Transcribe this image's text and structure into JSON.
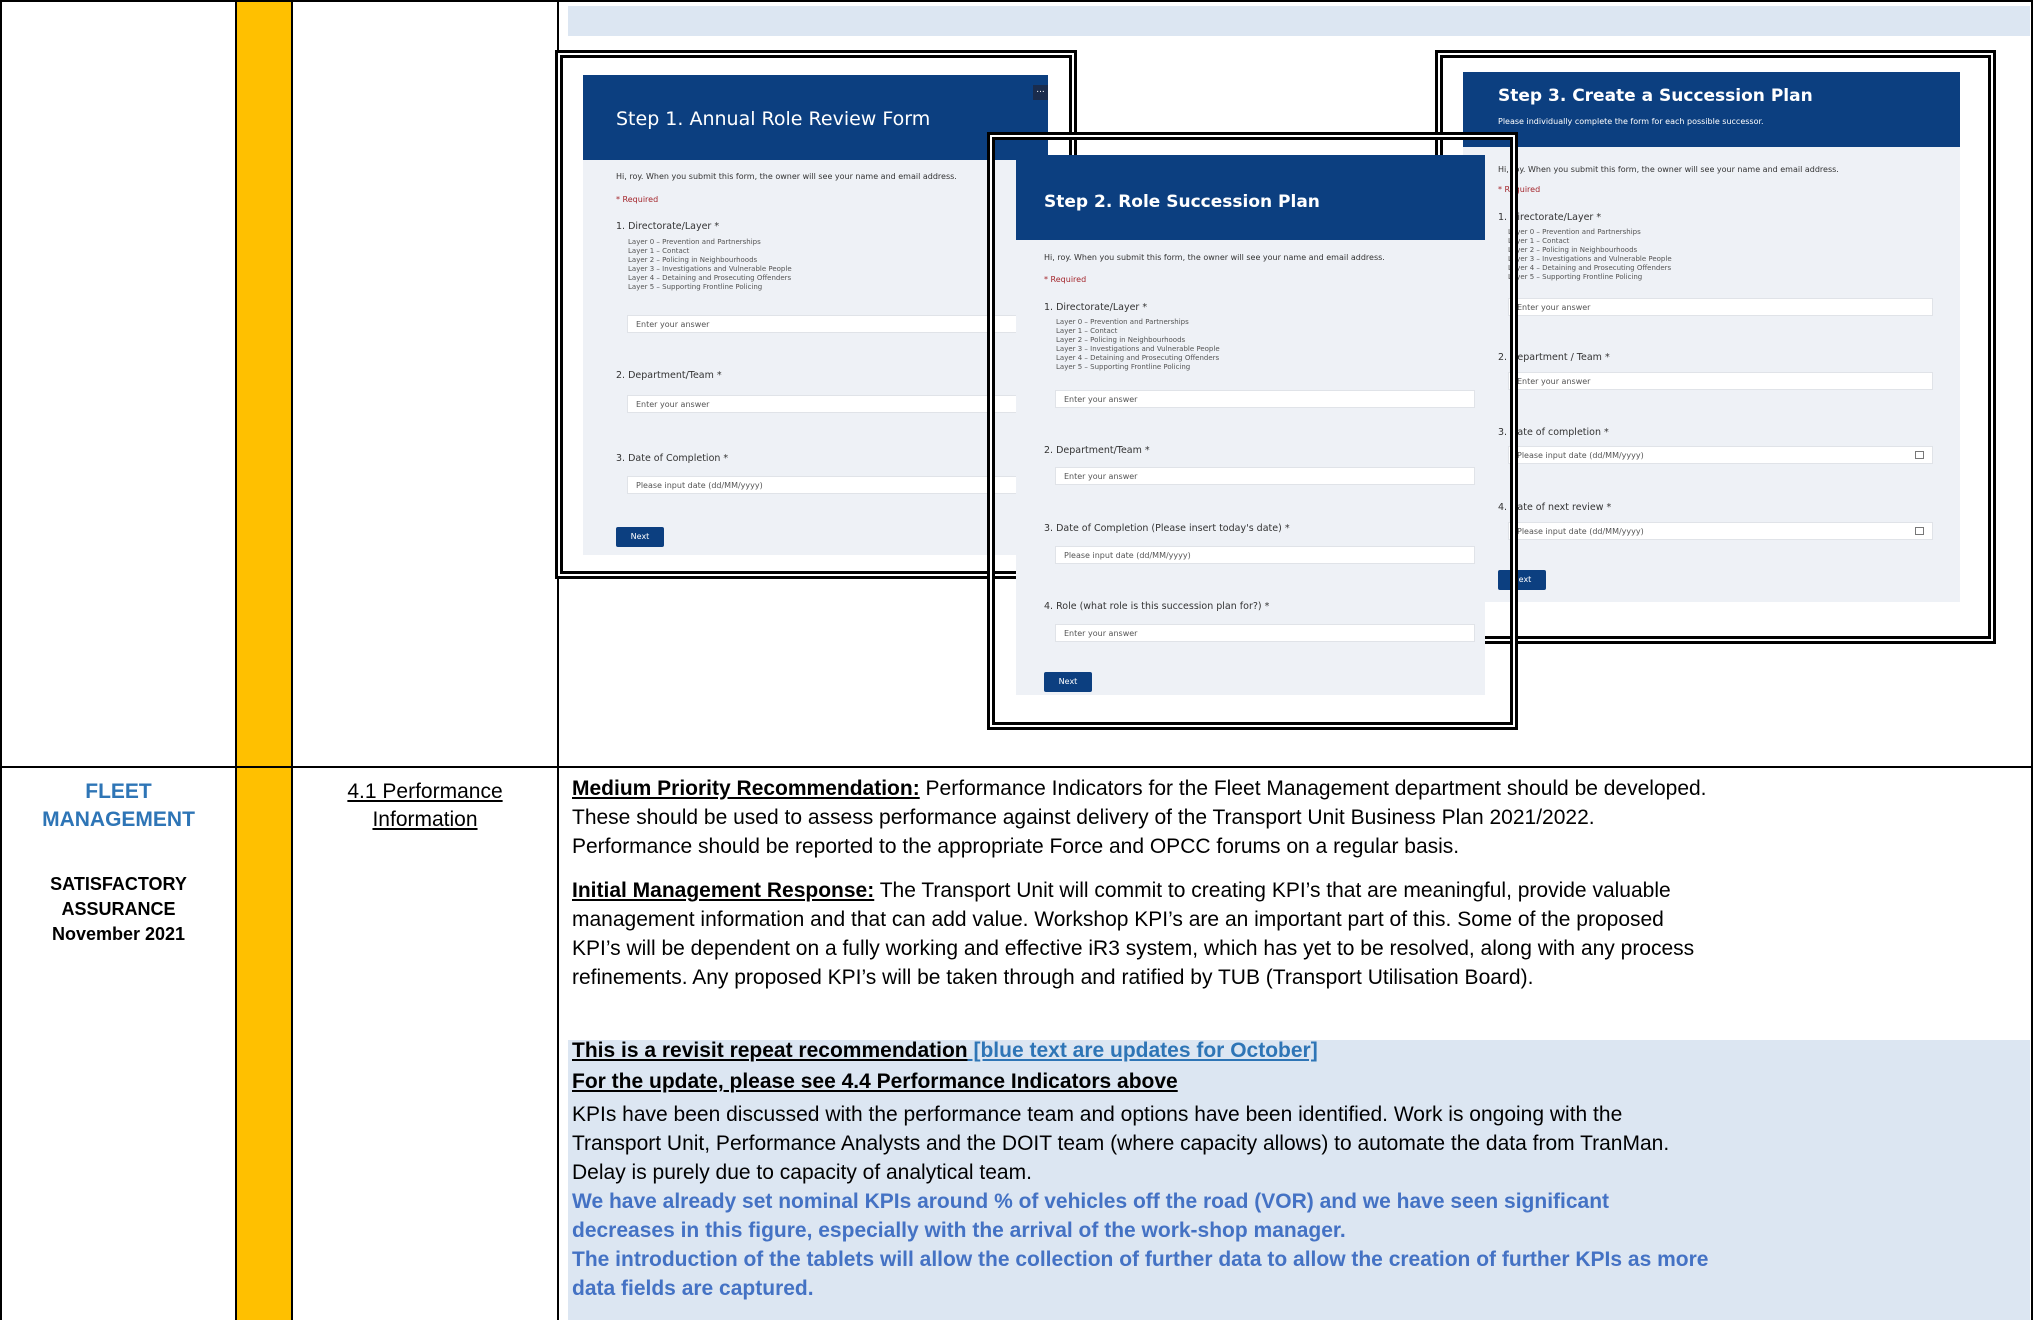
{
  "left_col": {
    "category_line1": "FLEET",
    "category_line2": "MANAGEMENT",
    "assurance_line1": "SATISFACTORY",
    "assurance_line2": "ASSURANCE",
    "date": "November 2021"
  },
  "ref": {
    "line1": "4.1 Performance",
    "line2": "Information"
  },
  "form1": {
    "title": "Step 1. Annual Role Review Form",
    "intro": "Hi, roy. When you submit this form, the owner will see your name and email address.",
    "required": "* Required",
    "q1_label": "1. Directorate/Layer *",
    "layers": [
      "Layer 0 – Prevention and Partnerships",
      "Layer 1 – Contact",
      "Layer 2 – Policing in Neighbourhoods",
      "Layer 3 – Investigations and Vulnerable People",
      "Layer 4 – Detaining and Prosecuting Offenders",
      "Layer 5 – Supporting Frontline Policing"
    ],
    "answer_placeholder": "Enter your answer",
    "q2_label": "2. Department/Team *",
    "q3_label": "3. Date of Completion *",
    "date_placeholder": "Please input date (dd/MM/yyyy)",
    "next": "Next",
    "more": "..."
  },
  "form2": {
    "title": "Step 2. Role Succession Plan",
    "intro": "Hi, roy. When you submit this form, the owner will see your name and email address.",
    "required": "* Required",
    "q1_label": "1. Directorate/Layer *",
    "layers": [
      "Layer 0 – Prevention and Partnerships",
      "Layer 1 – Contact",
      "Layer 2 – Policing in Neighbourhoods",
      "Layer 3 – Investigations and Vulnerable People",
      "Layer 4 – Detaining and Prosecuting Offenders",
      "Layer 5 – Supporting Frontline Policing"
    ],
    "answer_placeholder": "Enter your answer",
    "q2_label": "2. Department/Team *",
    "q3_label": "3. Date of Completion (Please insert today's date) *",
    "date_placeholder": "Please input date (dd/MM/yyyy)",
    "q4_label": "4. Role (what role is this succession plan for?) *",
    "next": "Next"
  },
  "form3": {
    "title": "Step 3. Create a Succession Plan",
    "subtitle": "Please individually complete the form for each possible successor.",
    "intro": "Hi, roy. When you submit this form, the owner will see your name and email address.",
    "required": "* Required",
    "q1_label": "1. Directorate/Layer *",
    "layers": [
      "Layer 0 – Prevention and Partnerships",
      "Layer 1 – Contact",
      "Layer 2 – Policing in Neighbourhoods",
      "Layer 3 – Investigations and Vulnerable People",
      "Layer 4 – Detaining and Prosecuting Offenders",
      "Layer 5 – Supporting Frontline Policing"
    ],
    "answer_placeholder": "Enter your answer",
    "q2_label": "2. Department / Team *",
    "q3_label": "3. Date of completion *",
    "date_placeholder": "Please input date (dd/MM/yyyy)",
    "q4_label": "4. Date of next review *",
    "next": "Next"
  },
  "recommendation": {
    "heading": "Medium Priority Recommendation:",
    "text_l1": " Performance Indicators for the Fleet Management department should be developed.",
    "text_l2": "These should be used to assess performance against delivery of the Transport Unit Business Plan 2021/2022.",
    "text_l3": "Performance should be reported to the appropriate Force and OPCC forums on a regular basis."
  },
  "response": {
    "heading": "Initial Management Response:",
    "text_l1": " The Transport Unit will commit to creating KPI’s that are meaningful, provide valuable",
    "text_l2": "management information and that can add value. Workshop KPI’s are an important part of this. Some of the proposed",
    "text_l3": "KPI’s will be dependent on a fully working and effective iR3 system, which has yet to be resolved, along with any process",
    "text_l4": "refinements. Any proposed KPI’s will be taken through and ratified by TUB (Transport Utilisation Board)."
  },
  "update": {
    "repeat_heading": "This is a revisit repeat recommendation",
    "repeat_note": " [blue text are updates for October]",
    "see_heading": "For the update, please see 4.4 Performance Indicators above",
    "body_l1": "KPIs have been discussed with the performance team and options have been identified. Work is ongoing with the",
    "body_l2": "Transport Unit, Performance Analysts and the DOIT team (where capacity allows) to automate the data from TranMan.",
    "body_l3": "Delay is purely due to capacity of analytical team.",
    "blue_l1": "We have already set nominal KPIs around % of vehicles off the road (VOR) and we have seen significant",
    "blue_l2": "decreases in this figure, especially with the arrival of the work-shop manager.",
    "blue_l3": "The introduction of the tablets will allow the collection of further data to allow the creation of further KPIs as more",
    "blue_l4": "data fields are captured."
  },
  "colors": {
    "accent_bar": "#ffc000",
    "update_bg": "#dce6f2",
    "blue_text": "#4472c4",
    "category_blue": "#2e75b6",
    "form_header": "#0c3f80"
  }
}
